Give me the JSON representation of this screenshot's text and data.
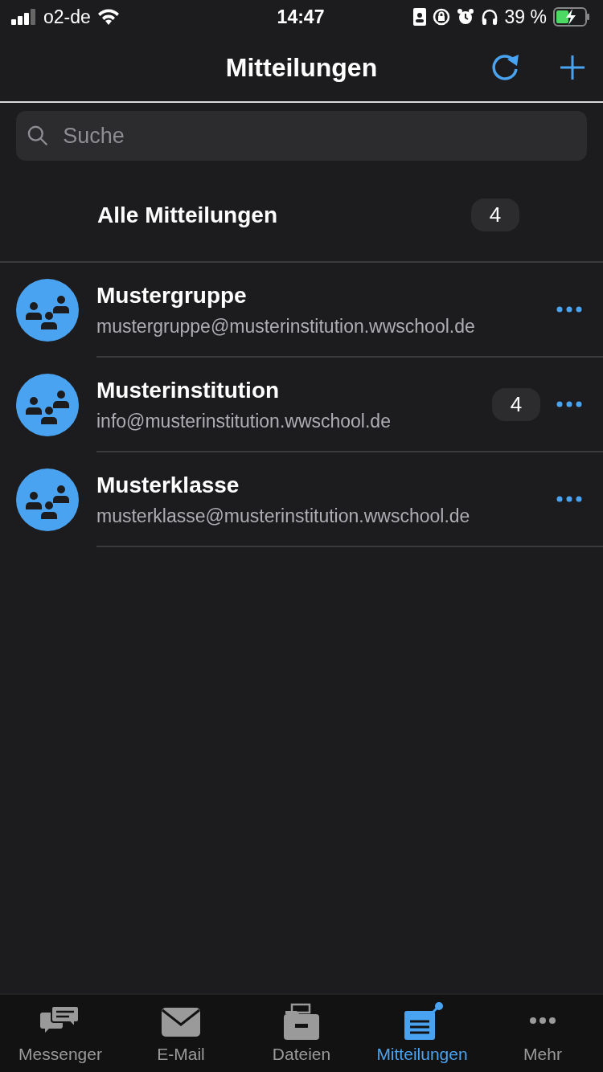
{
  "status_bar": {
    "carrier": "o2-de",
    "time": "14:47",
    "battery": "39 %"
  },
  "header": {
    "title": "Mitteilungen"
  },
  "search": {
    "placeholder": "Suche"
  },
  "all": {
    "label": "Alle Mitteilungen",
    "count": "4"
  },
  "groups": [
    {
      "name": "Mustergruppe",
      "email": "mustergruppe@musterinstitution.wwschool.de"
    },
    {
      "name": "Musterinstitution",
      "email": "info@musterinstitution.wwschool.de",
      "count": "4"
    },
    {
      "name": "Musterklasse",
      "email": "musterklasse@musterinstitution.wwschool.de"
    }
  ],
  "tabs": [
    {
      "kind": "messenger",
      "label": "Messenger",
      "selected": false
    },
    {
      "kind": "email",
      "label": "E-Mail",
      "selected": false
    },
    {
      "kind": "files",
      "label": "Dateien",
      "selected": false
    },
    {
      "kind": "notices",
      "label": "Mitteilungen",
      "selected": true
    },
    {
      "kind": "more",
      "label": "Mehr",
      "selected": false
    }
  ]
}
